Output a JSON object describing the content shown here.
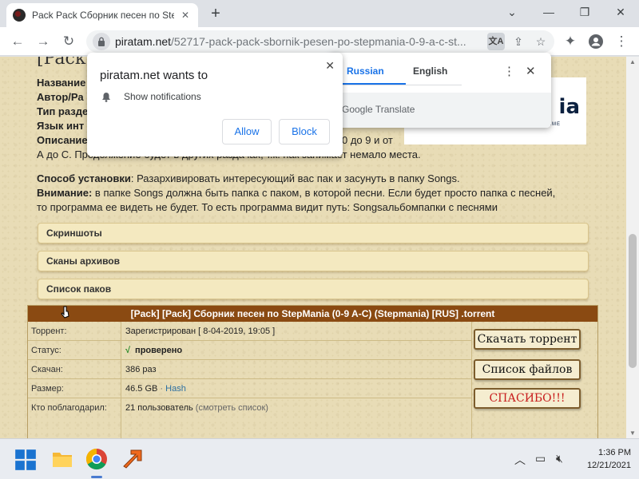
{
  "browser": {
    "tab_title": "Pack Pack Сборник песен по Ste",
    "tab_close": "✕",
    "new_tab": "+",
    "url_host": "piratam.net",
    "url_path": "/52717-pack-pack-sbornik-pesen-po-stepmania-0-9-a-c-st..."
  },
  "page": {
    "title_partial": "[Pack",
    "meta_labels": [
      "Название",
      "Автор/Ра",
      "Тип разде",
      "Язык инт",
      "Описание"
    ],
    "desc_right": "0 до 9 и от",
    "desc_line2": "А до С. Продолжение будет в других раздачах, т.к. пак занимает немало места.",
    "install_label": "Способ установки",
    "install_text": ": Разархивировать интересующий вас пак и засунуть в папку Songs.",
    "warning_label": "Внимание:",
    "warning_text": " в папке Songs должна быть папка с паком, в которой песни. Если будет просто папка с песней,",
    "warning_text2": "то программа ее видеть не будет. То есть программа видит путь: Songsальбомпапки с песнями",
    "spoilers": [
      "Скриншоты",
      "Сканы архивов",
      "Список паков"
    ],
    "logo_text": "ia",
    "logo_sub": "GAME"
  },
  "torrent": {
    "header": "[Pack] [Pack] Сборник песен по StepMania (0-9 A-C) (Stepmania) [RUS] .torrent",
    "rows": [
      {
        "key": "Торрент:",
        "value": "Зарегистрирован   [ 8-04-2019, 19:05 ]"
      },
      {
        "key": "Статус:",
        "check": "√",
        "value": "проверено"
      },
      {
        "key": "Скачан:",
        "value": "386 раз"
      },
      {
        "key": "Размер:",
        "value": "46.5 GB",
        "dot": " · ",
        "link": "Hash"
      },
      {
        "key": "Кто поблагодарил:",
        "value": "21 пользователь",
        "paren": " (смотреть список)"
      }
    ],
    "buttons": {
      "download": "Скачать торрент",
      "files": "Список файлов",
      "thanks": "СПАСИБО!!!"
    }
  },
  "notification_prompt": {
    "title": "piratam.net wants to",
    "permission": "Show notifications",
    "allow": "Allow",
    "block": "Block",
    "close": "✕"
  },
  "translate": {
    "lang_from": "Russian",
    "lang_to": "English",
    "footer": "Google Translate",
    "menu": "⋮",
    "close": "✕"
  },
  "taskbar": {
    "time": "1:36 PM",
    "date": "12/21/2021"
  }
}
